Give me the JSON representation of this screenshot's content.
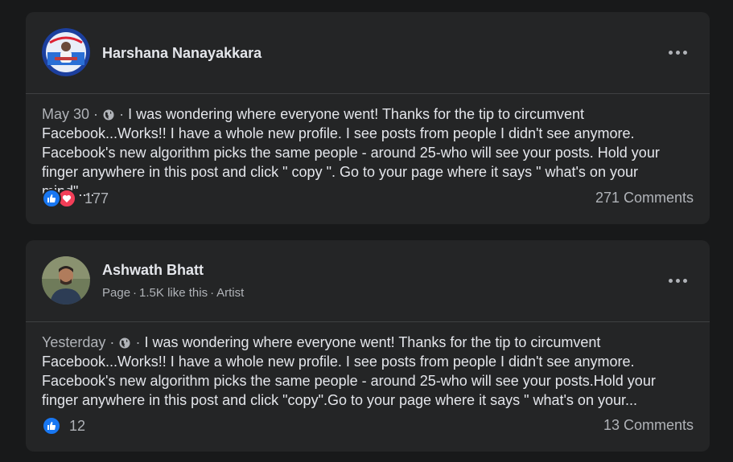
{
  "posts": [
    {
      "author": "Harshana Nanayakkara",
      "meta": [],
      "date": "May 30",
      "text": "I was wondering where everyone went! Thanks for the tip to circumvent Facebook...Works!! I have a whole new profile. I see posts from people I didn't see anymore. Facebook's new algorithm picks the same people - around 25-who will see your posts. Hold your finger anywhere in this post and click \" copy \". Go to your page where it says \" what's on your mind\"....",
      "reactions": [
        "like-icon",
        "love-icon"
      ],
      "reaction_count": "177",
      "comments": "271 Comments"
    },
    {
      "author": "Ashwath Bhatt",
      "meta": [
        "Page",
        "1.5K like this",
        "Artist"
      ],
      "date": "Yesterday",
      "text": "I was wondering where everyone went! Thanks for the tip to circumvent Facebook...Works!! I have a whole new profile. I see posts from people I didn't see anymore. Facebook's new algorithm picks the same people - around 25-who will see your posts.Hold your finger anywhere in this post and click \"copy\".Go to your page where it says \" what's on your...",
      "reactions": [
        "like-icon"
      ],
      "reaction_count": "12",
      "comments": "13 Comments"
    }
  ],
  "colors": {
    "background": "#18191a",
    "card": "#242526",
    "primary_text": "#e4e6eb",
    "secondary_text": "#b0b3b8",
    "like": "#1877f2",
    "love": "#f33e58"
  }
}
